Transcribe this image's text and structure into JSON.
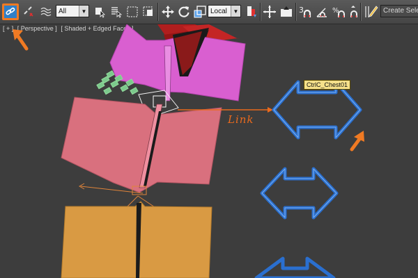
{
  "toolbar": {
    "buttons": [
      {
        "name": "select-and-link-icon",
        "active": true
      },
      {
        "name": "unlink-selection-icon"
      },
      {
        "name": "bind-to-space-warp-icon"
      },
      {
        "name": "select-object-icon"
      },
      {
        "name": "select-by-name-icon"
      },
      {
        "name": "rectangular-selection-icon"
      },
      {
        "name": "window-crossing-icon"
      },
      {
        "name": "select-and-move-icon"
      },
      {
        "name": "select-and-rotate-icon"
      },
      {
        "name": "select-and-scale-icon"
      },
      {
        "name": "use-pivot-center-icon"
      },
      {
        "name": "select-and-manipulate-icon"
      },
      {
        "name": "keyboard-shortcut-override-icon"
      },
      {
        "name": "snaps-toggle-icon"
      },
      {
        "name": "angle-snap-icon"
      },
      {
        "name": "percent-snap-icon"
      },
      {
        "name": "spinner-snap-icon"
      },
      {
        "name": "edit-named-selection-sets-icon"
      }
    ],
    "selection_filter": "All",
    "reference_coord_system": "Local",
    "named_selection_set_placeholder": "Create Selection Se",
    "snap_3_label": "3",
    "percent_label": "%"
  },
  "viewport": {
    "labels": [
      "[ + ]",
      "[ Perspective ]",
      "[ Shaded + Edged Faces ]"
    ],
    "tooltip": "CtrlC_Chest01",
    "annotation": "Link",
    "colors": {
      "background": "#3d3d3d",
      "accent_orange": "#f07a23",
      "control_blue": "#2a6fcf",
      "magenta_mesh": "#d95fd0",
      "pink_mesh": "#d9707e",
      "orange_mesh": "#d99a43",
      "red_mesh": "#b01e1e"
    }
  }
}
